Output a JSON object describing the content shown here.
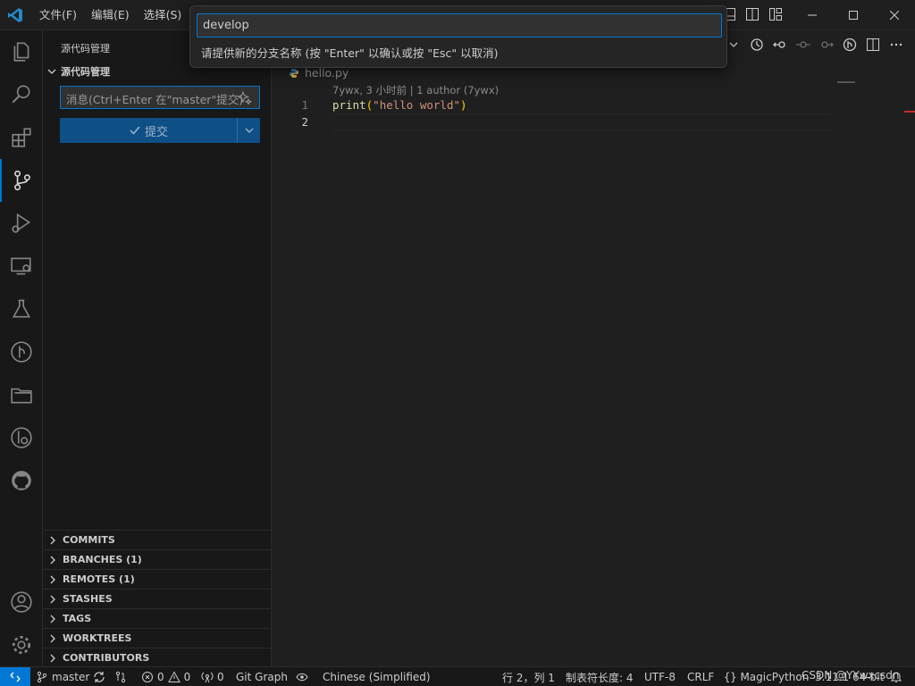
{
  "menu": {
    "file": "文件(F)",
    "edit": "编辑(E)",
    "selection": "选择(S)"
  },
  "quick_input": {
    "value": "develop",
    "message": "请提供新的分支名称 (按 \"Enter\" 以确认或按 \"Esc\" 以取消)"
  },
  "sidebar": {
    "title": "源代码管理",
    "section": "源代码管理",
    "commit_placeholder": "消息(Ctrl+Enter 在\"master\"提交)",
    "commit_button": "提交",
    "panels": [
      "COMMITS",
      "BRANCHES (1)",
      "REMOTES (1)",
      "STASHES",
      "TAGS",
      "WORKTREES",
      "CONTRIBUTORS"
    ]
  },
  "editor": {
    "tab_name": "hello.py",
    "blame": "7ywx, 3 小时前 | 1 author (7ywx)",
    "line_numbers": [
      "1",
      "2"
    ],
    "code": {
      "fn": "print",
      "open": "(",
      "str": "\"hello world\"",
      "close": ")"
    }
  },
  "statusbar": {
    "branch": "master",
    "errors": "0",
    "warnings": "0",
    "ports": "0",
    "git_graph": "Git Graph",
    "language_pack": "Chinese (Simplified)",
    "position": "行 2，列 1",
    "tab_size": "制表符长度: 4",
    "encoding": "UTF-8",
    "eol": "CRLF",
    "language": "MagicPython",
    "interpreter": "3.11.1 64-bit",
    "watermark": "CSDN @YYwxcsdn"
  },
  "colors": {
    "accent": "#0078d4",
    "background": "#1f1f1f",
    "sidebar": "#181818",
    "commit_button": "#0e4f86"
  }
}
